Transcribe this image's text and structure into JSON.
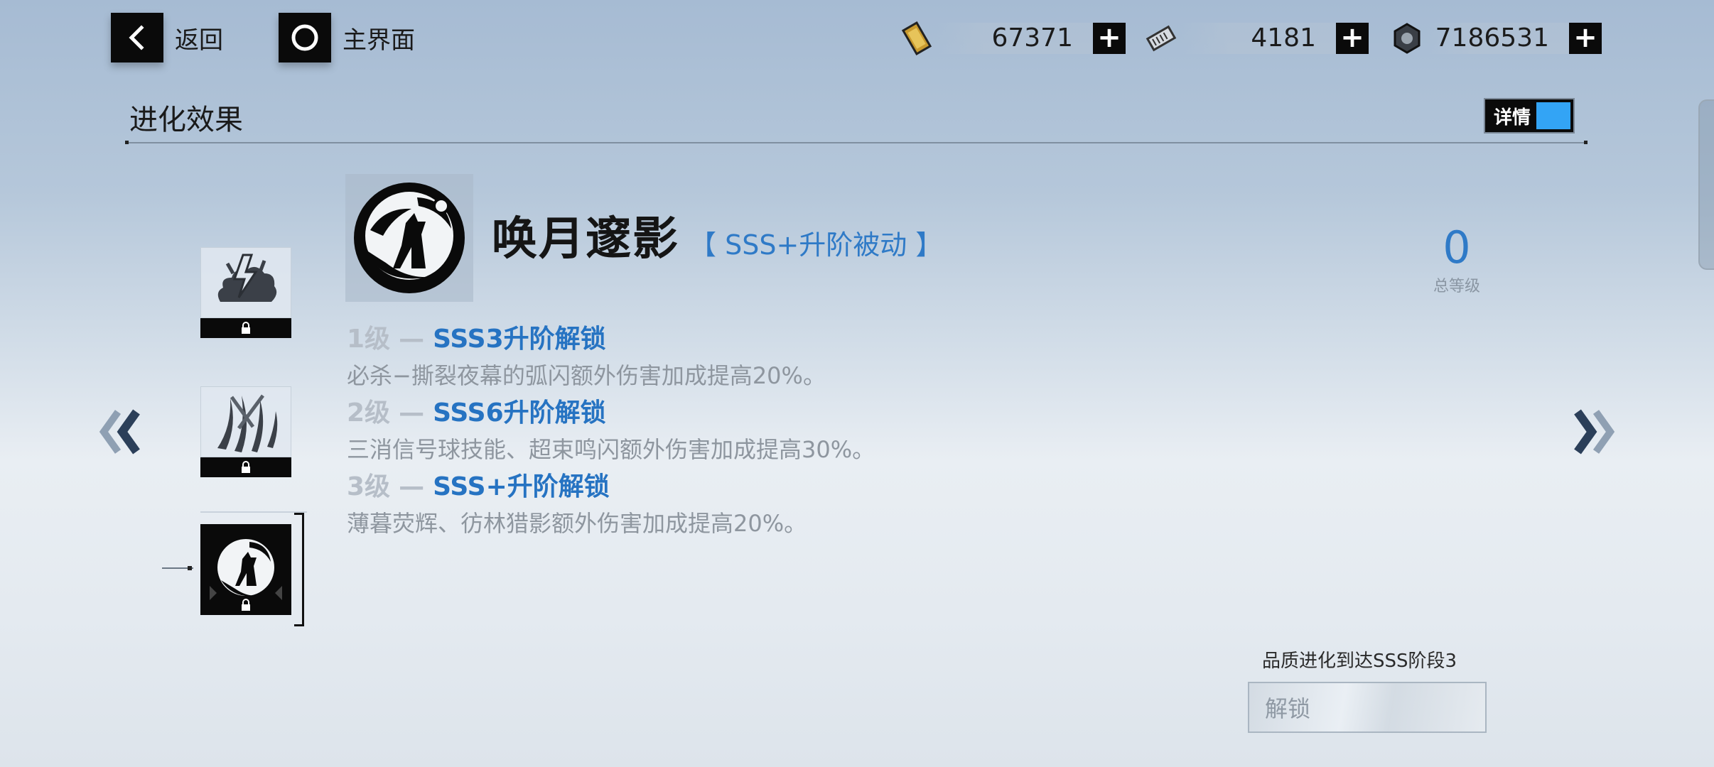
{
  "top_bar": {
    "back_label": "返回",
    "home_label": "主界面",
    "resources": [
      {
        "icon": "gold-ticket-icon",
        "value": "67371"
      },
      {
        "icon": "chip-card-icon",
        "value": "4181"
      },
      {
        "icon": "nut-icon",
        "value": "7186531"
      }
    ]
  },
  "header": {
    "title": "进化效果",
    "detail_label": "详情",
    "toggle_color": "#33a4f5"
  },
  "skill": {
    "name": "唤月邃影",
    "tag": "【 SSS+升阶被动 】",
    "total_level": "0",
    "total_level_label": "总等级",
    "levels": [
      {
        "level": "1级",
        "requirement": "SSS3升阶解锁",
        "desc": "必杀−撕裂夜幕的弧闪额外伤害加成提高20%。"
      },
      {
        "level": "2级",
        "requirement": "SSS6升阶解锁",
        "desc": "三消信号球技能、超束鸣闪额外伤害加成提高30%。"
      },
      {
        "level": "3级",
        "requirement": "SSS+升阶解锁",
        "desc": "薄暮荧辉、彷林猎影额外伤害加成提高20%。"
      }
    ]
  },
  "side_list": {
    "items": [
      {
        "icon": "lightning-cloud-icon"
      },
      {
        "icon": "claw-slash-icon"
      },
      {
        "icon": "wolf-moon-icon"
      }
    ]
  },
  "footer": {
    "condition": "品质进化到达SSS阶段3",
    "unlock_label": "解锁"
  },
  "colors": {
    "accent_blue": "#2f7ac7",
    "dark": "#0a0a0a"
  }
}
